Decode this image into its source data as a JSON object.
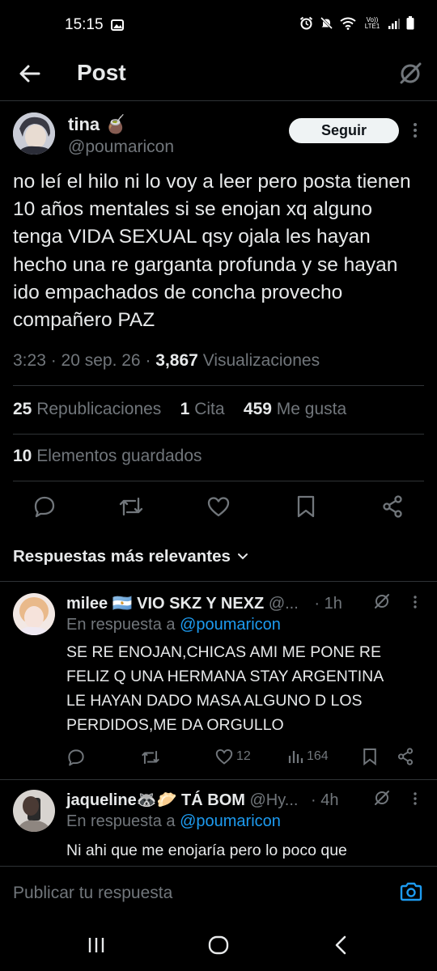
{
  "status_bar": {
    "time": "15:15",
    "network": "Vo)) LTE1"
  },
  "header": {
    "title": "Post",
    "icons": [
      "back-arrow-icon",
      "grok-icon"
    ]
  },
  "tweet": {
    "author_name": "tina 🧉",
    "author_handle": "@poumaricon",
    "follow_label": "Seguir",
    "text": "no leí el hilo ni lo voy a leer pero posta tienen 10 años mentales si se enojan xq alguno tenga VIDA SEXUAL qsy ojala les hayan hecho una re garganta profunda y se hayan ido empachados de concha provecho compañero PAZ",
    "time": "3:23 · 20 sep. 26 ·",
    "views_count": "3,867",
    "views_label": "Visualizaciones",
    "reposts_count": "25",
    "reposts_label": "Republicaciones",
    "quotes_count": "1",
    "quotes_label": "Cita",
    "likes_count": "459",
    "likes_label": "Me gusta",
    "bookmarks_count": "10",
    "bookmarks_label": "Elementos guardados"
  },
  "sort_label": "Respuestas más relevantes",
  "replies": [
    {
      "name": "milee 🇦🇷 VIO SKZ Y NEXZ",
      "handle": "@...",
      "time": "· 1h",
      "reply_prefix": "En respuesta a",
      "reply_to": "@poumaricon",
      "text_lines": [
        "SE RE ENOJAN,CHICAS AMI ME PONE RE",
        "FELIZ Q UNA HERMANA STAY ARGENTINA",
        "LE HAYAN DADO MASA ALGUNO D LOS",
        "PERDIDOS,ME DA ORGULLO"
      ],
      "likes": "12",
      "views": "164"
    },
    {
      "name": "jaqueline🦝🥟 TÁ BOM",
      "handle": "@Hy...",
      "time": "· 4h",
      "reply_prefix": "En respuesta a",
      "reply_to": "@poumaricon",
      "text_lines": [
        "Ni ahi que me enojaría pero lo poco que"
      ]
    }
  ],
  "composer": {
    "placeholder": "Publicar tu respuesta"
  },
  "colors": {
    "background": "#000000",
    "text": "#e7e9ea",
    "muted": "#71767b",
    "link": "#1d9bf0",
    "divider": "#2f3336"
  }
}
